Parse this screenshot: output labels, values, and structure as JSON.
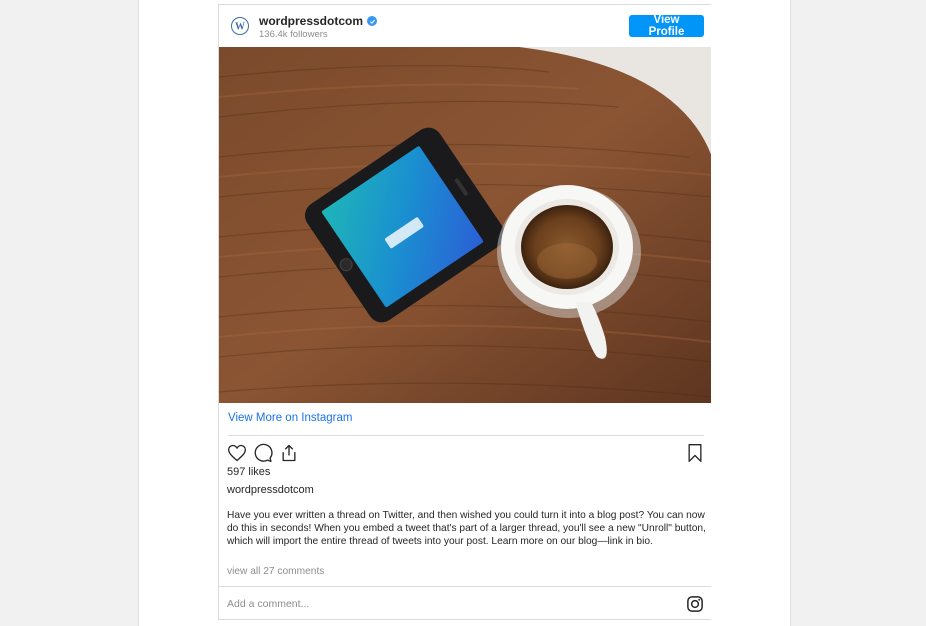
{
  "profile": {
    "username": "wordpressdotcom",
    "followers": "136.4k followers",
    "view_profile_label": "View Profile"
  },
  "post": {
    "view_more_label": "View More on Instagram",
    "likes": "597 likes",
    "caption_user": "wordpressdotcom",
    "caption": "Have you ever written a thread on Twitter, and then wished you could turn it into a blog post? You can now do this in seconds! When you embed a tweet that's part of a larger thread, you'll see a new \"Unroll\" button, which will import the entire thread of tweets into your post. Learn more on our blog—link in bio.",
    "comments_link": "view all 27 comments"
  },
  "comment": {
    "placeholder": "Add a comment..."
  },
  "icons": {
    "avatar": "wordpress-logo-icon",
    "verified": "verified-badge-icon",
    "like": "heart-icon",
    "comment": "comment-bubble-icon",
    "share": "share-icon",
    "save": "bookmark-icon",
    "instagram": "instagram-icon"
  },
  "colors": {
    "accent": "#0095f6",
    "link": "#1a73e8",
    "verified": "#3897f0",
    "muted": "#8e8e8e"
  }
}
